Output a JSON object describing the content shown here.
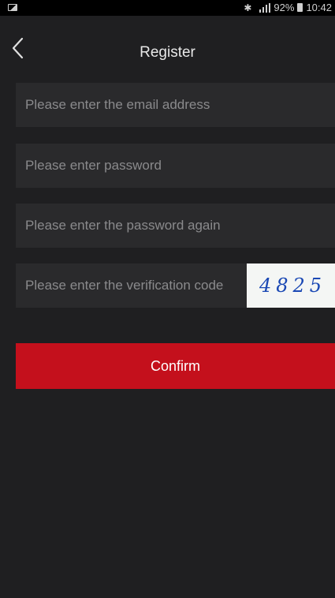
{
  "status_bar": {
    "battery": "92%",
    "time": "10:42",
    "icons": [
      "gallery-icon",
      "bluetooth-icon",
      "wifi-icon",
      "signal-icon",
      "battery-icon"
    ]
  },
  "header": {
    "title": "Register",
    "back_icon": "chevron-left-icon"
  },
  "form": {
    "email_placeholder": "Please enter the email address",
    "password_placeholder": "Please enter password",
    "password_again_placeholder": "Please enter the password again",
    "verification_placeholder": "Please enter the verification code",
    "captcha_text": "4825",
    "confirm_label": "Confirm"
  },
  "colors": {
    "background": "#1f1f21",
    "field_background": "#2a2a2c",
    "accent": "#c4101c",
    "captcha_ink": "#1a48b4"
  }
}
